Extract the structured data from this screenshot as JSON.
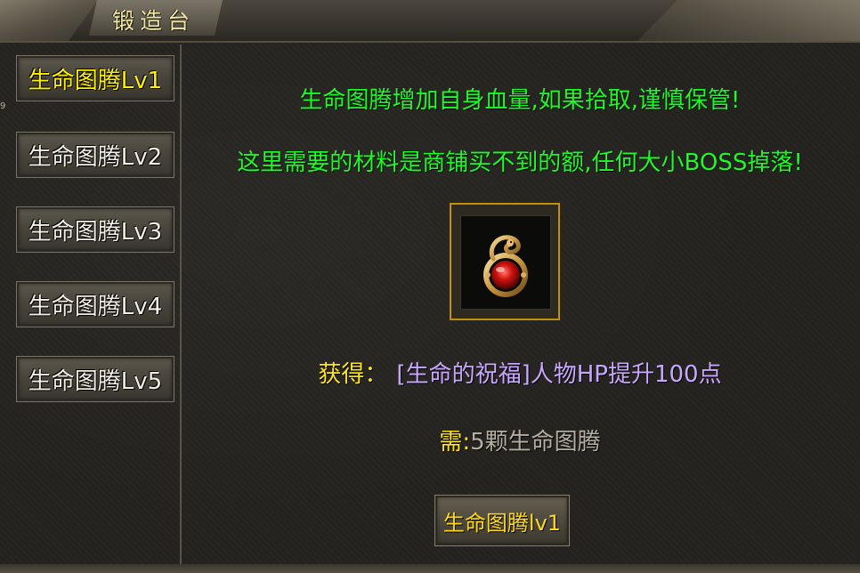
{
  "window": {
    "title": "锻造台"
  },
  "sidebar": {
    "edge_mark": "9",
    "items": [
      {
        "label": "生命图腾Lv1",
        "active": true
      },
      {
        "label": "生命图腾Lv2",
        "active": false
      },
      {
        "label": "生命图腾Lv3",
        "active": false
      },
      {
        "label": "生命图腾Lv4",
        "active": false
      },
      {
        "label": "生命图腾Lv5",
        "active": false
      }
    ]
  },
  "main": {
    "line1": "生命图腾增加自身血量,如果拾取,谨慎保管!",
    "line2": "这里需要的材料是商铺买不到的额,任何大小BOSS掉落!",
    "item_icon": "serpent-amulet-icon",
    "reward_label": "获得：",
    "reward_value": "[生命的祝福]人物HP提升100点",
    "need_label": "需:",
    "need_value": "5颗生命图腾",
    "action_label": "生命图腾lv1"
  },
  "colors": {
    "highlight_text": "#1dfb26",
    "active_tab": "#fff200",
    "label_yellow": "#ffe419",
    "reward_purple": "#c9a7ff",
    "slot_border": "#c29010"
  }
}
